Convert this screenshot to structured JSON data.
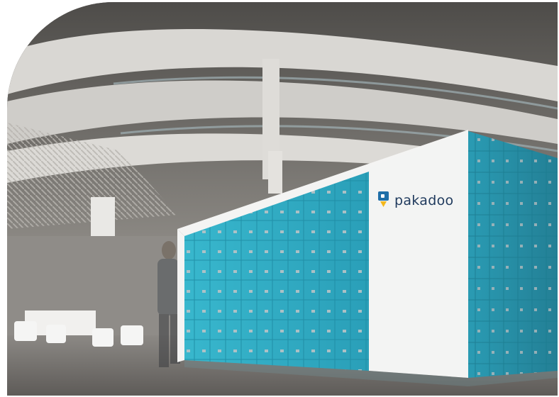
{
  "image": {
    "brand": {
      "name": "pakadoo",
      "icon": "pakadoo-logo-icon"
    },
    "colors": {
      "locker_teal": "#2fa9c2",
      "locker_teal_light": "#55c2d6",
      "panel_white": "#f3f4f3",
      "brand_text": "#1f3a5d",
      "logo_yellow": "#f3b81c"
    },
    "scene": "atrium-with-parcel-locker-station"
  }
}
